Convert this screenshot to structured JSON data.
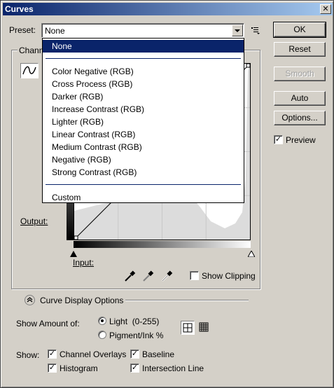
{
  "window": {
    "title": "Curves",
    "close_glyph": "✕"
  },
  "preset": {
    "label": "Preset:",
    "value": "None",
    "menu_icon": "preset-options-icon",
    "options": [
      "None",
      "Color Negative (RGB)",
      "Cross Process (RGB)",
      "Darker (RGB)",
      "Increase Contrast (RGB)",
      "Lighter (RGB)",
      "Linear Contrast (RGB)",
      "Medium Contrast (RGB)",
      "Negative (RGB)",
      "Strong Contrast (RGB)",
      "Custom"
    ]
  },
  "buttons": {
    "ok": "OK",
    "reset": "Reset",
    "smooth": "Smooth",
    "auto": "Auto",
    "options": "Options..."
  },
  "preview": {
    "label": "Preview",
    "checked": true
  },
  "channel_label_partial": "Chann",
  "graph": {
    "output_label": "Output:",
    "input_label": "Input:"
  },
  "show_clipping": {
    "label": "Show Clipping",
    "checked": false
  },
  "curve_display_options": {
    "label": "Curve Display Options",
    "expanded": true
  },
  "show_amount": {
    "label": "Show Amount of:",
    "light": "Light  (0-255)",
    "pigment": "Pigment/Ink %",
    "selected": "light"
  },
  "show": {
    "label": "Show:",
    "channel_overlays": "Channel Overlays",
    "baseline": "Baseline",
    "histogram": "Histogram",
    "intersection_line": "Intersection Line"
  },
  "colors": {
    "selection": "#0a246a",
    "dialog_bg": "#d4d0c8",
    "title_gradient_start": "#0a246a",
    "title_gradient_end": "#a6caf0"
  }
}
